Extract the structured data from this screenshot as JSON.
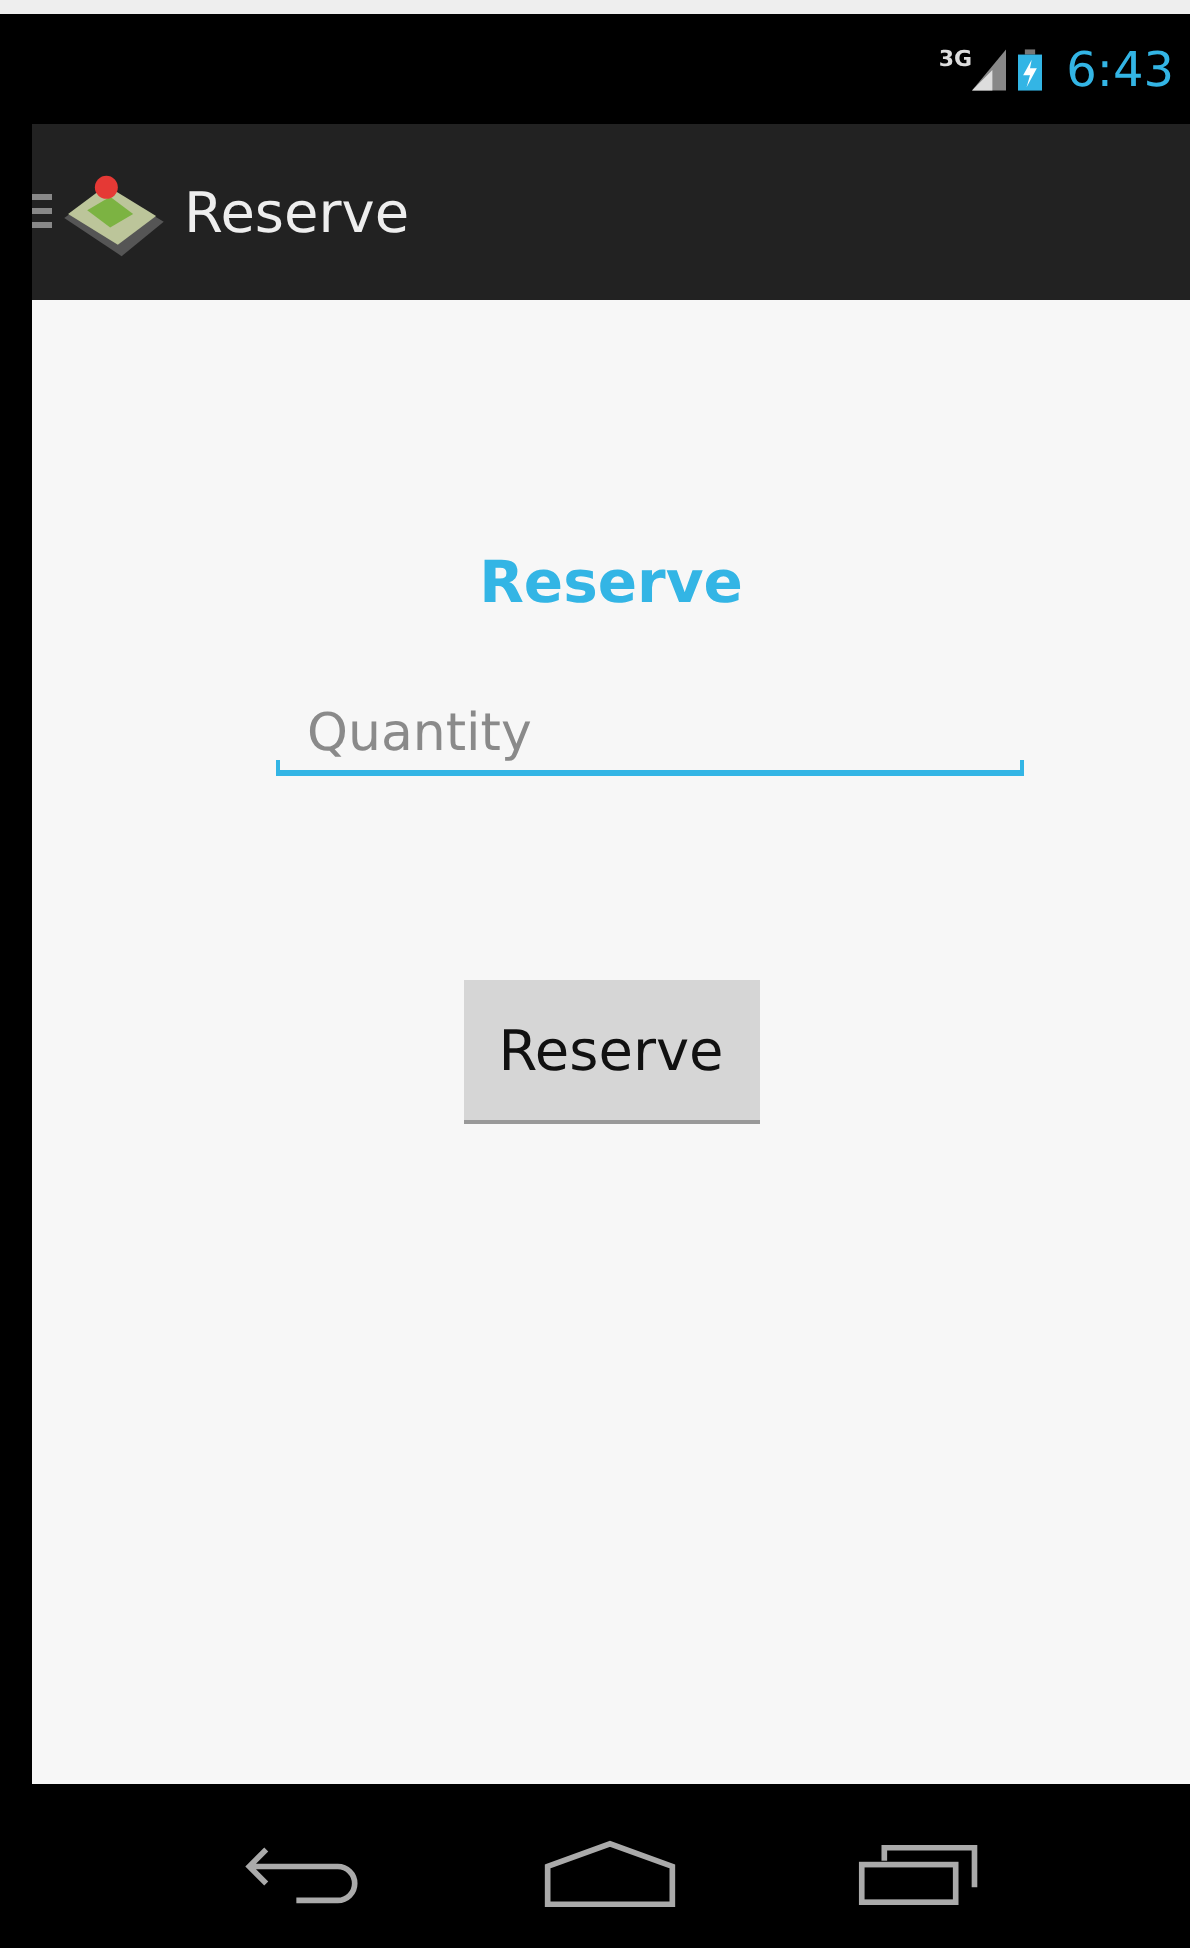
{
  "status_bar": {
    "network": "3G",
    "time": "6:43"
  },
  "action_bar": {
    "title": "Reserve"
  },
  "form": {
    "heading": "Reserve",
    "quantity_field": {
      "placeholder": "Quantity"
    },
    "submit_button": "Reserve"
  }
}
